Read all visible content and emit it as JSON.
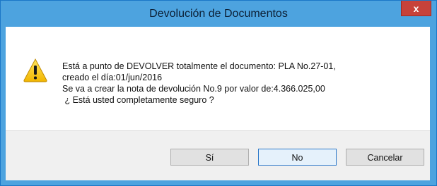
{
  "window": {
    "title": "Devolución de Documentos",
    "close_glyph": "x"
  },
  "icon": {
    "name": "warning-icon",
    "color": "#f5c400"
  },
  "message": {
    "line1": "Está a punto de DEVOLVER totalmente el documento: PLA No.27-01,",
    "line2": "creado el día:01/jun/2016",
    "line3": "Se va a crear la nota de devolución No.9 por valor de:4.366.025,00",
    "line4": " ¿ Está usted completamente seguro ?"
  },
  "buttons": {
    "yes_label": "Sí",
    "no_label": "No",
    "cancel_label": "Cancelar"
  },
  "colors": {
    "titlebar": "#4da3df",
    "close": "#c7423a",
    "default_button_border": "#2c78c9"
  }
}
